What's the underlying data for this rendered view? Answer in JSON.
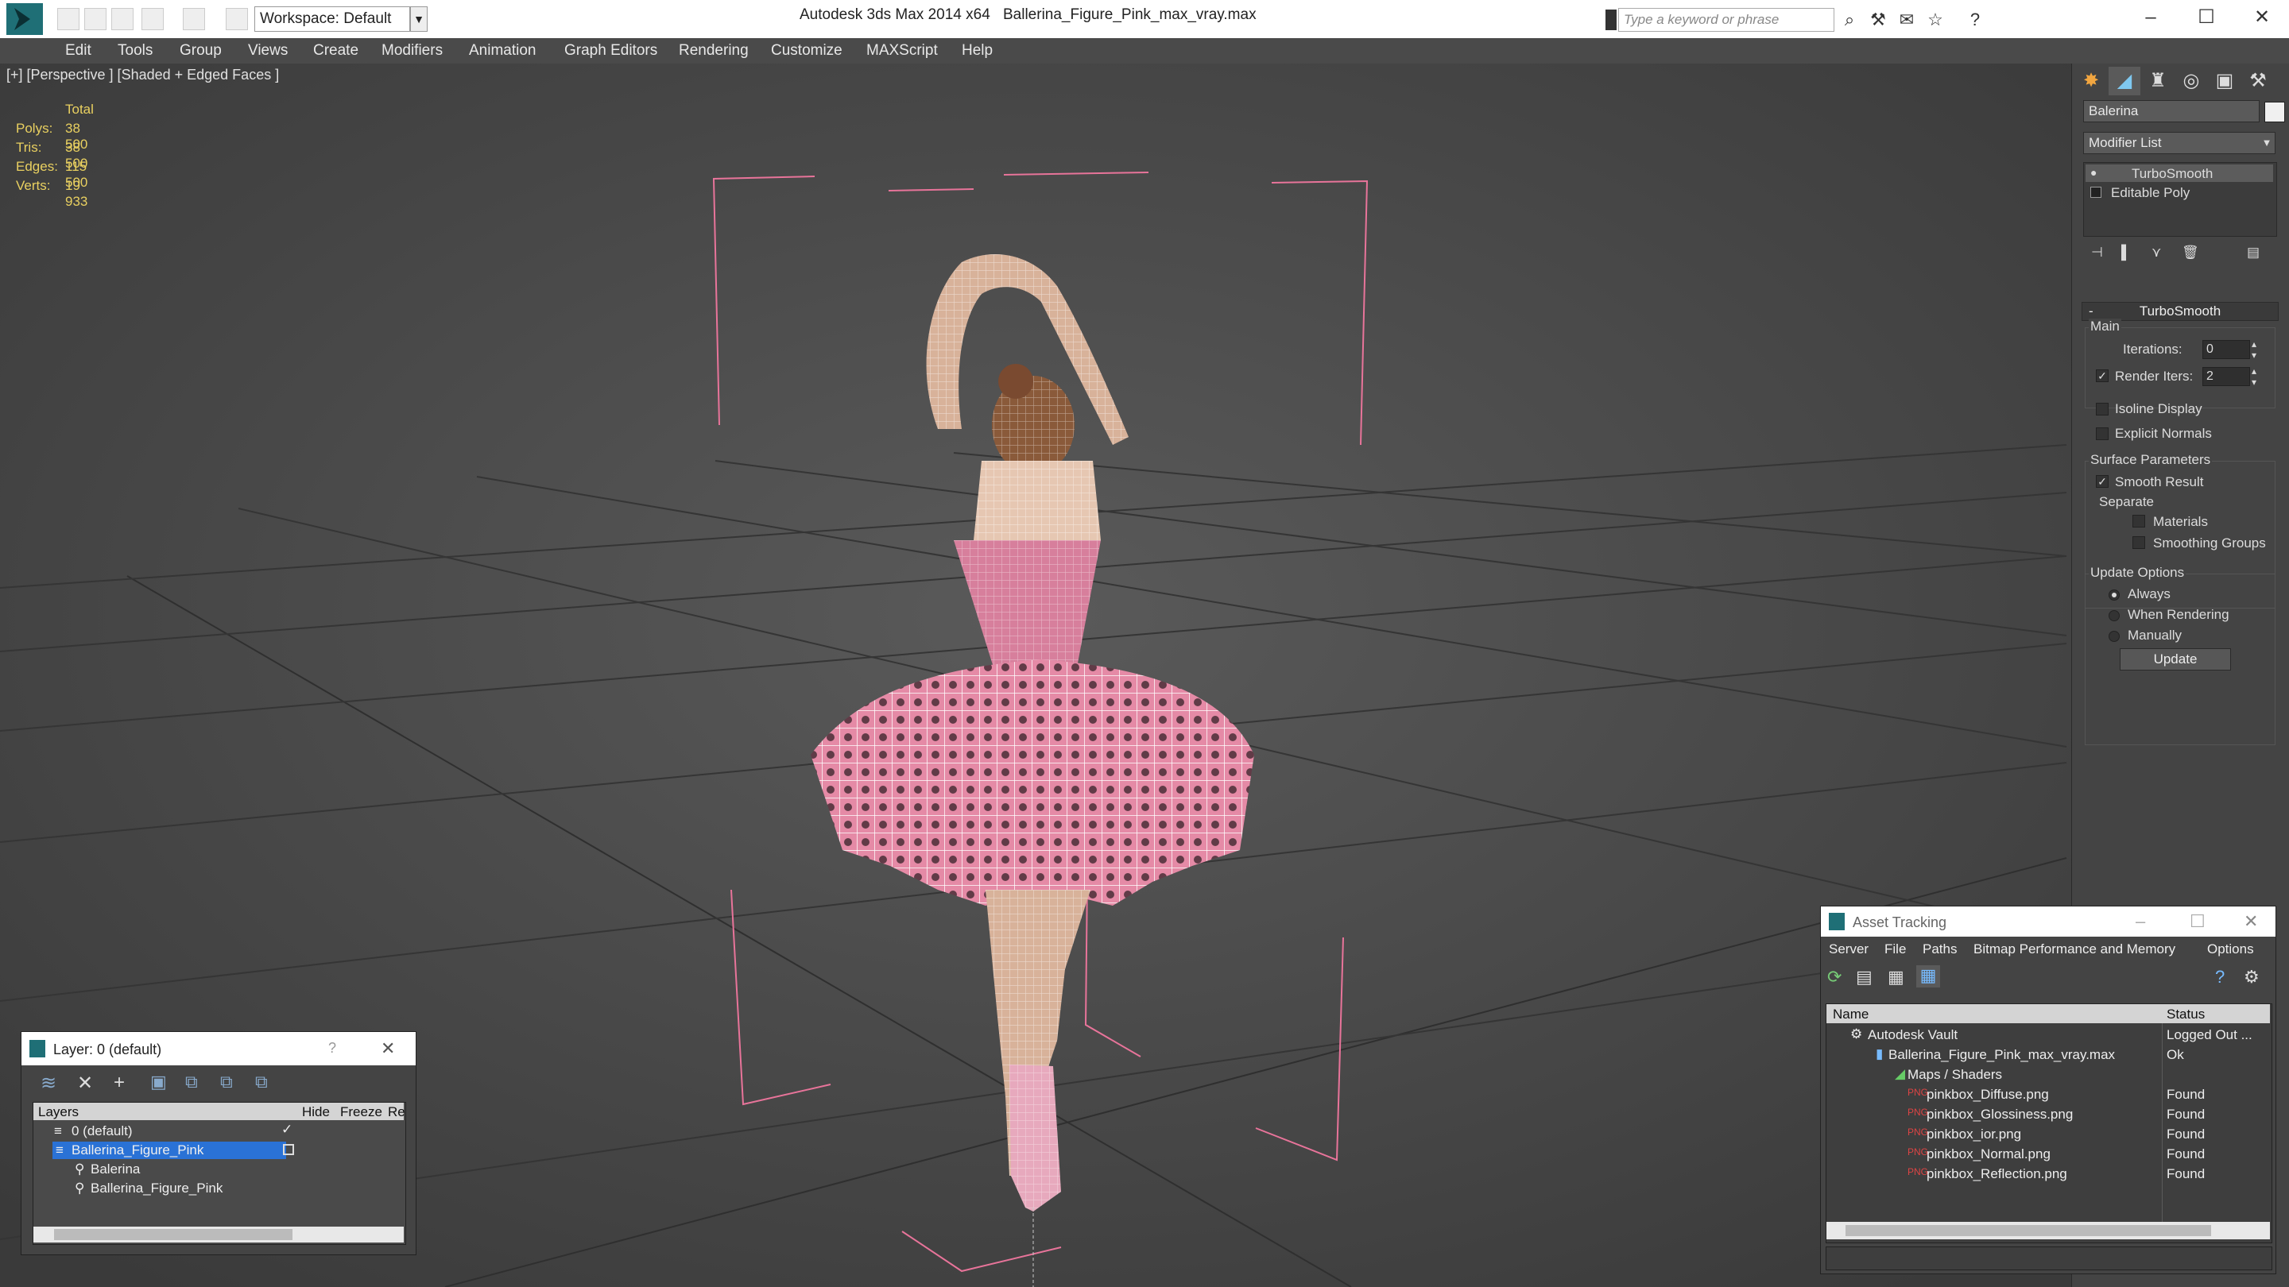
{
  "titlebar": {
    "workspace": "Workspace: Default",
    "app_title": "Autodesk 3ds Max  2014 x64",
    "file_title": "Ballerina_Figure_Pink_max_vray.max",
    "search_placeholder": "Type a keyword or phrase"
  },
  "menu": [
    "Edit",
    "Tools",
    "Group",
    "Views",
    "Create",
    "Modifiers",
    "Animation",
    "Graph Editors",
    "Rendering",
    "Customize",
    "MAXScript",
    "Help"
  ],
  "viewport": {
    "label": "[+] [Perspective ] [Shaded + Edged Faces ]",
    "stats": {
      "header": "Total",
      "polys_label": "Polys:",
      "polys": "38 500",
      "tris_label": "Tris:",
      "tris": "38 500",
      "edges_label": "Edges:",
      "edges": "115 500",
      "verts_label": "Verts:",
      "verts": "19 933"
    }
  },
  "command_panel": {
    "object_name": "Balerina",
    "modifier_list": "Modifier List",
    "stack": [
      "TurboSmooth",
      "Editable Poly"
    ],
    "rollout_title": "TurboSmooth",
    "main_group": "Main",
    "iterations_label": "Iterations:",
    "iterations": "0",
    "render_iters_label": "Render Iters:",
    "render_iters": "2",
    "isoline_display": "Isoline Display",
    "explicit_normals": "Explicit Normals",
    "surface_params": "Surface Parameters",
    "smooth_result": "Smooth Result",
    "separate": "Separate",
    "materials": "Materials",
    "smoothing_groups": "Smoothing Groups",
    "update_options": "Update Options",
    "always": "Always",
    "when_rendering": "When Rendering",
    "manually": "Manually",
    "update_button": "Update"
  },
  "layer_window": {
    "title": "Layer: 0 (default)",
    "help": "?",
    "columns": [
      "Layers",
      "Hide",
      "Freeze",
      "Re"
    ],
    "rows": [
      "0 (default)",
      "Ballerina_Figure_Pink",
      "Balerina",
      "Ballerina_Figure_Pink"
    ]
  },
  "asset_window": {
    "title": "Asset Tracking",
    "menu": [
      "Server",
      "File",
      "Paths",
      "Bitmap Performance and Memory",
      "Options"
    ],
    "columns": [
      "Name",
      "Status"
    ],
    "rows": [
      {
        "name": "Autodesk Vault",
        "status": "Logged Out ..."
      },
      {
        "name": "Ballerina_Figure_Pink_max_vray.max",
        "status": "Ok"
      },
      {
        "name": "Maps / Shaders",
        "status": ""
      },
      {
        "name": "pinkbox_Diffuse.png",
        "status": "Found"
      },
      {
        "name": "pinkbox_Glossiness.png",
        "status": "Found"
      },
      {
        "name": "pinkbox_ior.png",
        "status": "Found"
      },
      {
        "name": "pinkbox_Normal.png",
        "status": "Found"
      },
      {
        "name": "pinkbox_Reflection.png",
        "status": "Found"
      }
    ]
  }
}
